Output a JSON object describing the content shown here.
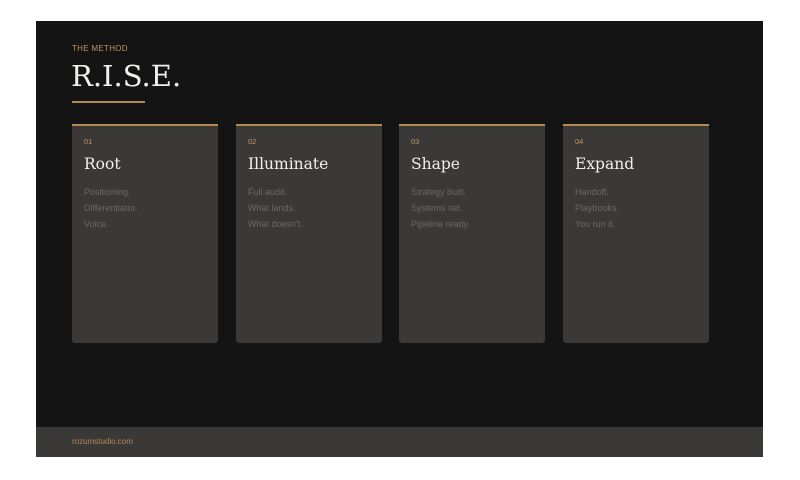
{
  "slide": {
    "eyebrow": "THE METHOD",
    "title": "R.I.S.E."
  },
  "cards": [
    {
      "number": "01",
      "name": "Root",
      "lines": [
        "Positioning.",
        "Differentiator.",
        "Voice."
      ]
    },
    {
      "number": "02",
      "name": "Illuminate",
      "lines": [
        "Full audit.",
        "What lands.",
        "What doesn't."
      ]
    },
    {
      "number": "03",
      "name": "Shape",
      "lines": [
        "Strategy built.",
        "Systems set.",
        "Pipeline ready."
      ]
    },
    {
      "number": "04",
      "name": "Expand",
      "lines": [
        "Handoff.",
        "Playbooks.",
        "You run it."
      ]
    }
  ],
  "footer": {
    "url": "rozumstudio.com"
  },
  "colors": {
    "accent": "#b38a55",
    "background": "#141414",
    "card": "#3a3938"
  }
}
